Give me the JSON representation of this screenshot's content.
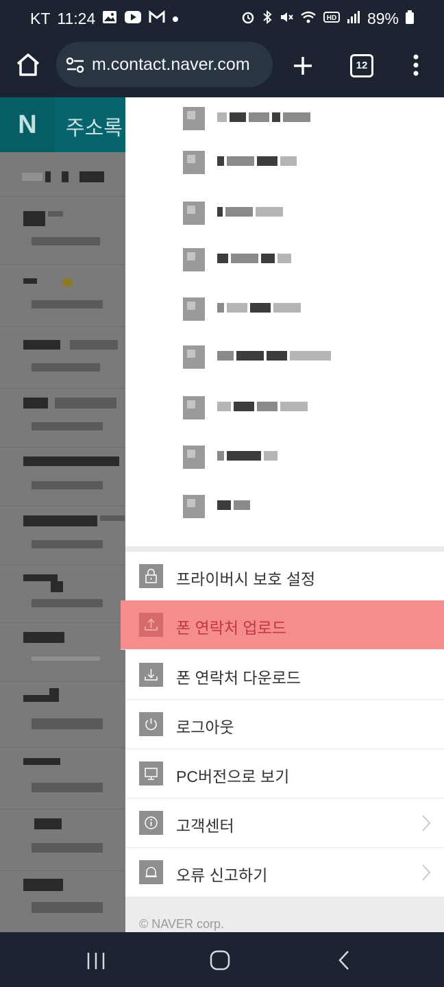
{
  "status_bar": {
    "carrier": "KT",
    "time": "11:24",
    "battery": "89%",
    "icons_left": [
      "gallery-icon",
      "youtube-icon",
      "gmail-icon",
      "dot-icon"
    ],
    "icons_right": [
      "alarm-icon",
      "bluetooth-icon",
      "mute-icon",
      "wifi-icon",
      "hd-icon",
      "signal-icon",
      "battery-icon"
    ]
  },
  "browser": {
    "url": "m.contact.naver.com",
    "tab_count": "12"
  },
  "background_page": {
    "logo": "N",
    "title": "주소록"
  },
  "drawer": {
    "menu": [
      {
        "label": "프라이버시 보호 설정",
        "icon": "lock-icon",
        "chevron": false,
        "highlighted": false
      },
      {
        "label": "폰 연락처 업로드",
        "icon": "upload-icon",
        "chevron": false,
        "highlighted": true
      },
      {
        "label": "폰 연락처 다운로드",
        "icon": "download-icon",
        "chevron": false,
        "highlighted": false
      },
      {
        "label": "로그아웃",
        "icon": "power-icon",
        "chevron": false,
        "highlighted": false
      },
      {
        "label": "PC버전으로 보기",
        "icon": "monitor-icon",
        "chevron": false,
        "highlighted": false
      },
      {
        "label": "고객센터",
        "icon": "info-icon",
        "chevron": true,
        "highlighted": false
      },
      {
        "label": "오류 신고하기",
        "icon": "bell-icon",
        "chevron": true,
        "highlighted": false
      }
    ],
    "footer": "© NAVER corp."
  },
  "colors": {
    "highlight": "#f58d8d",
    "highlight_text": "#c0393e",
    "brand_teal": "#05646c",
    "chrome_dark": "#1b2430"
  }
}
